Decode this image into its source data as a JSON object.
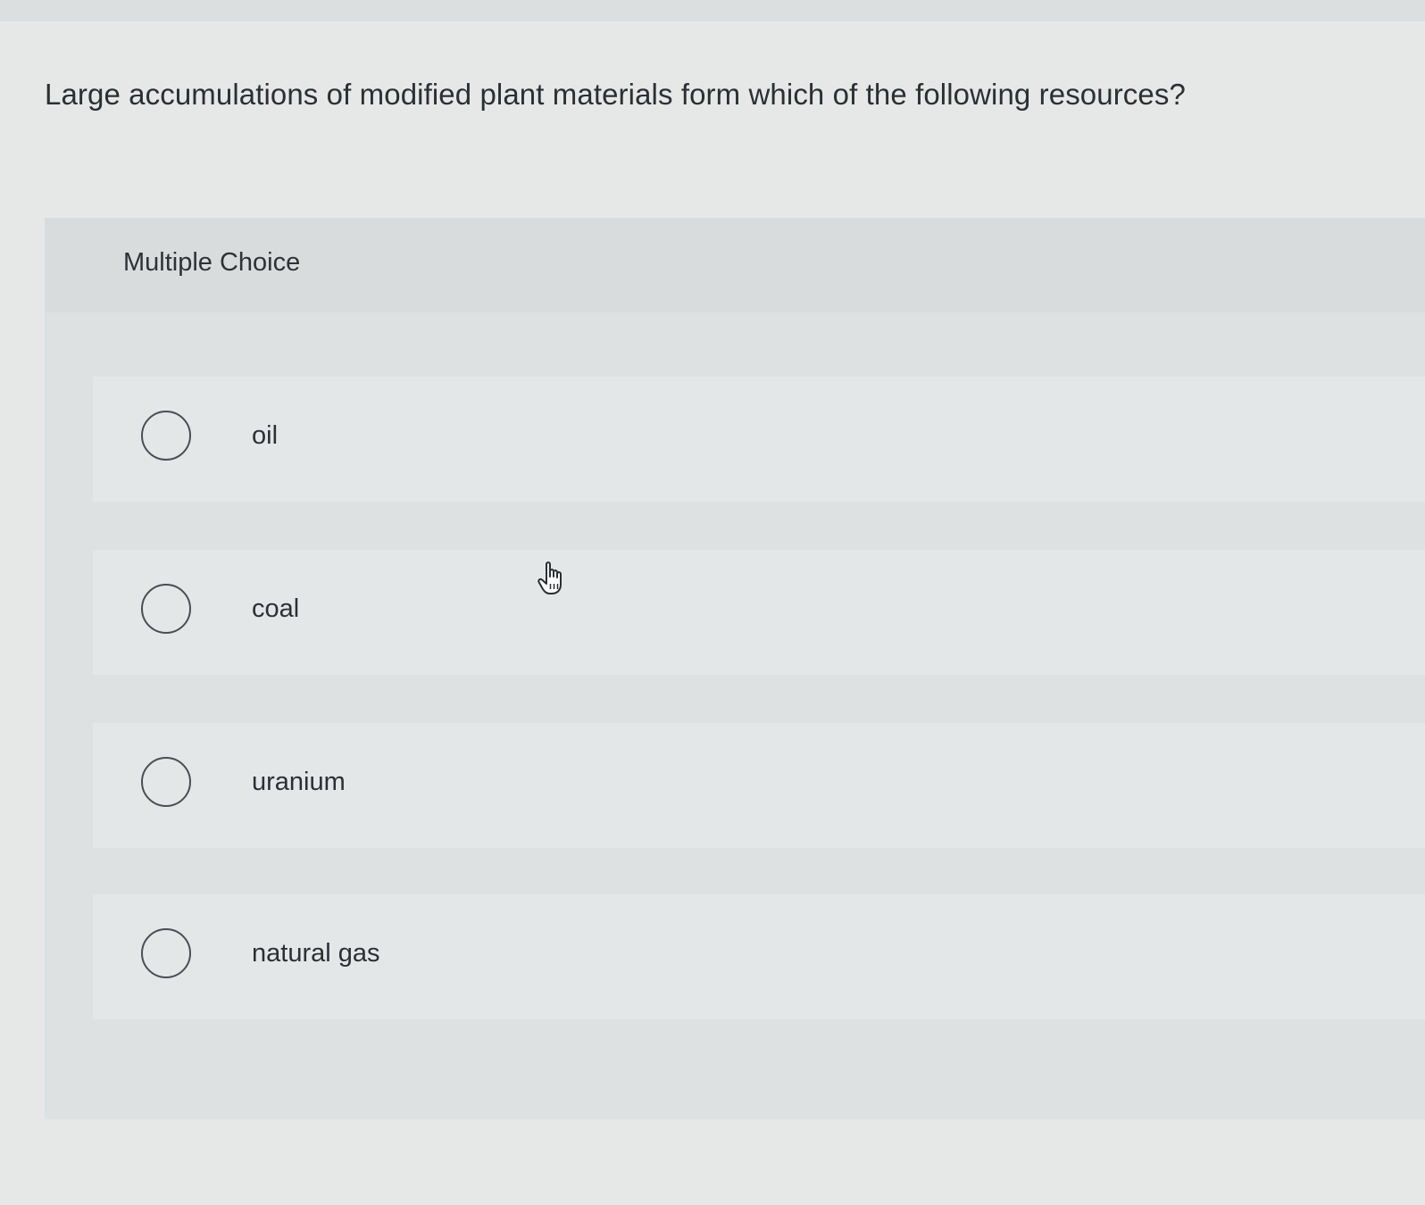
{
  "question": {
    "text": "Large accumulations of modified plant materials form which of the following resources?"
  },
  "multiple_choice": {
    "label": "Multiple Choice",
    "options": [
      {
        "label": "oil",
        "selected": false
      },
      {
        "label": "coal",
        "selected": false
      },
      {
        "label": "uranium",
        "selected": false
      },
      {
        "label": "natural gas",
        "selected": false
      }
    ]
  },
  "cursor": {
    "icon": "hand-pointer-icon"
  },
  "colors": {
    "background": "#e6e8e8",
    "panel": "#dde1e2",
    "option_row": "#e3e7e8",
    "text": "#2c2f33",
    "radio_border": "#4a4e52"
  }
}
